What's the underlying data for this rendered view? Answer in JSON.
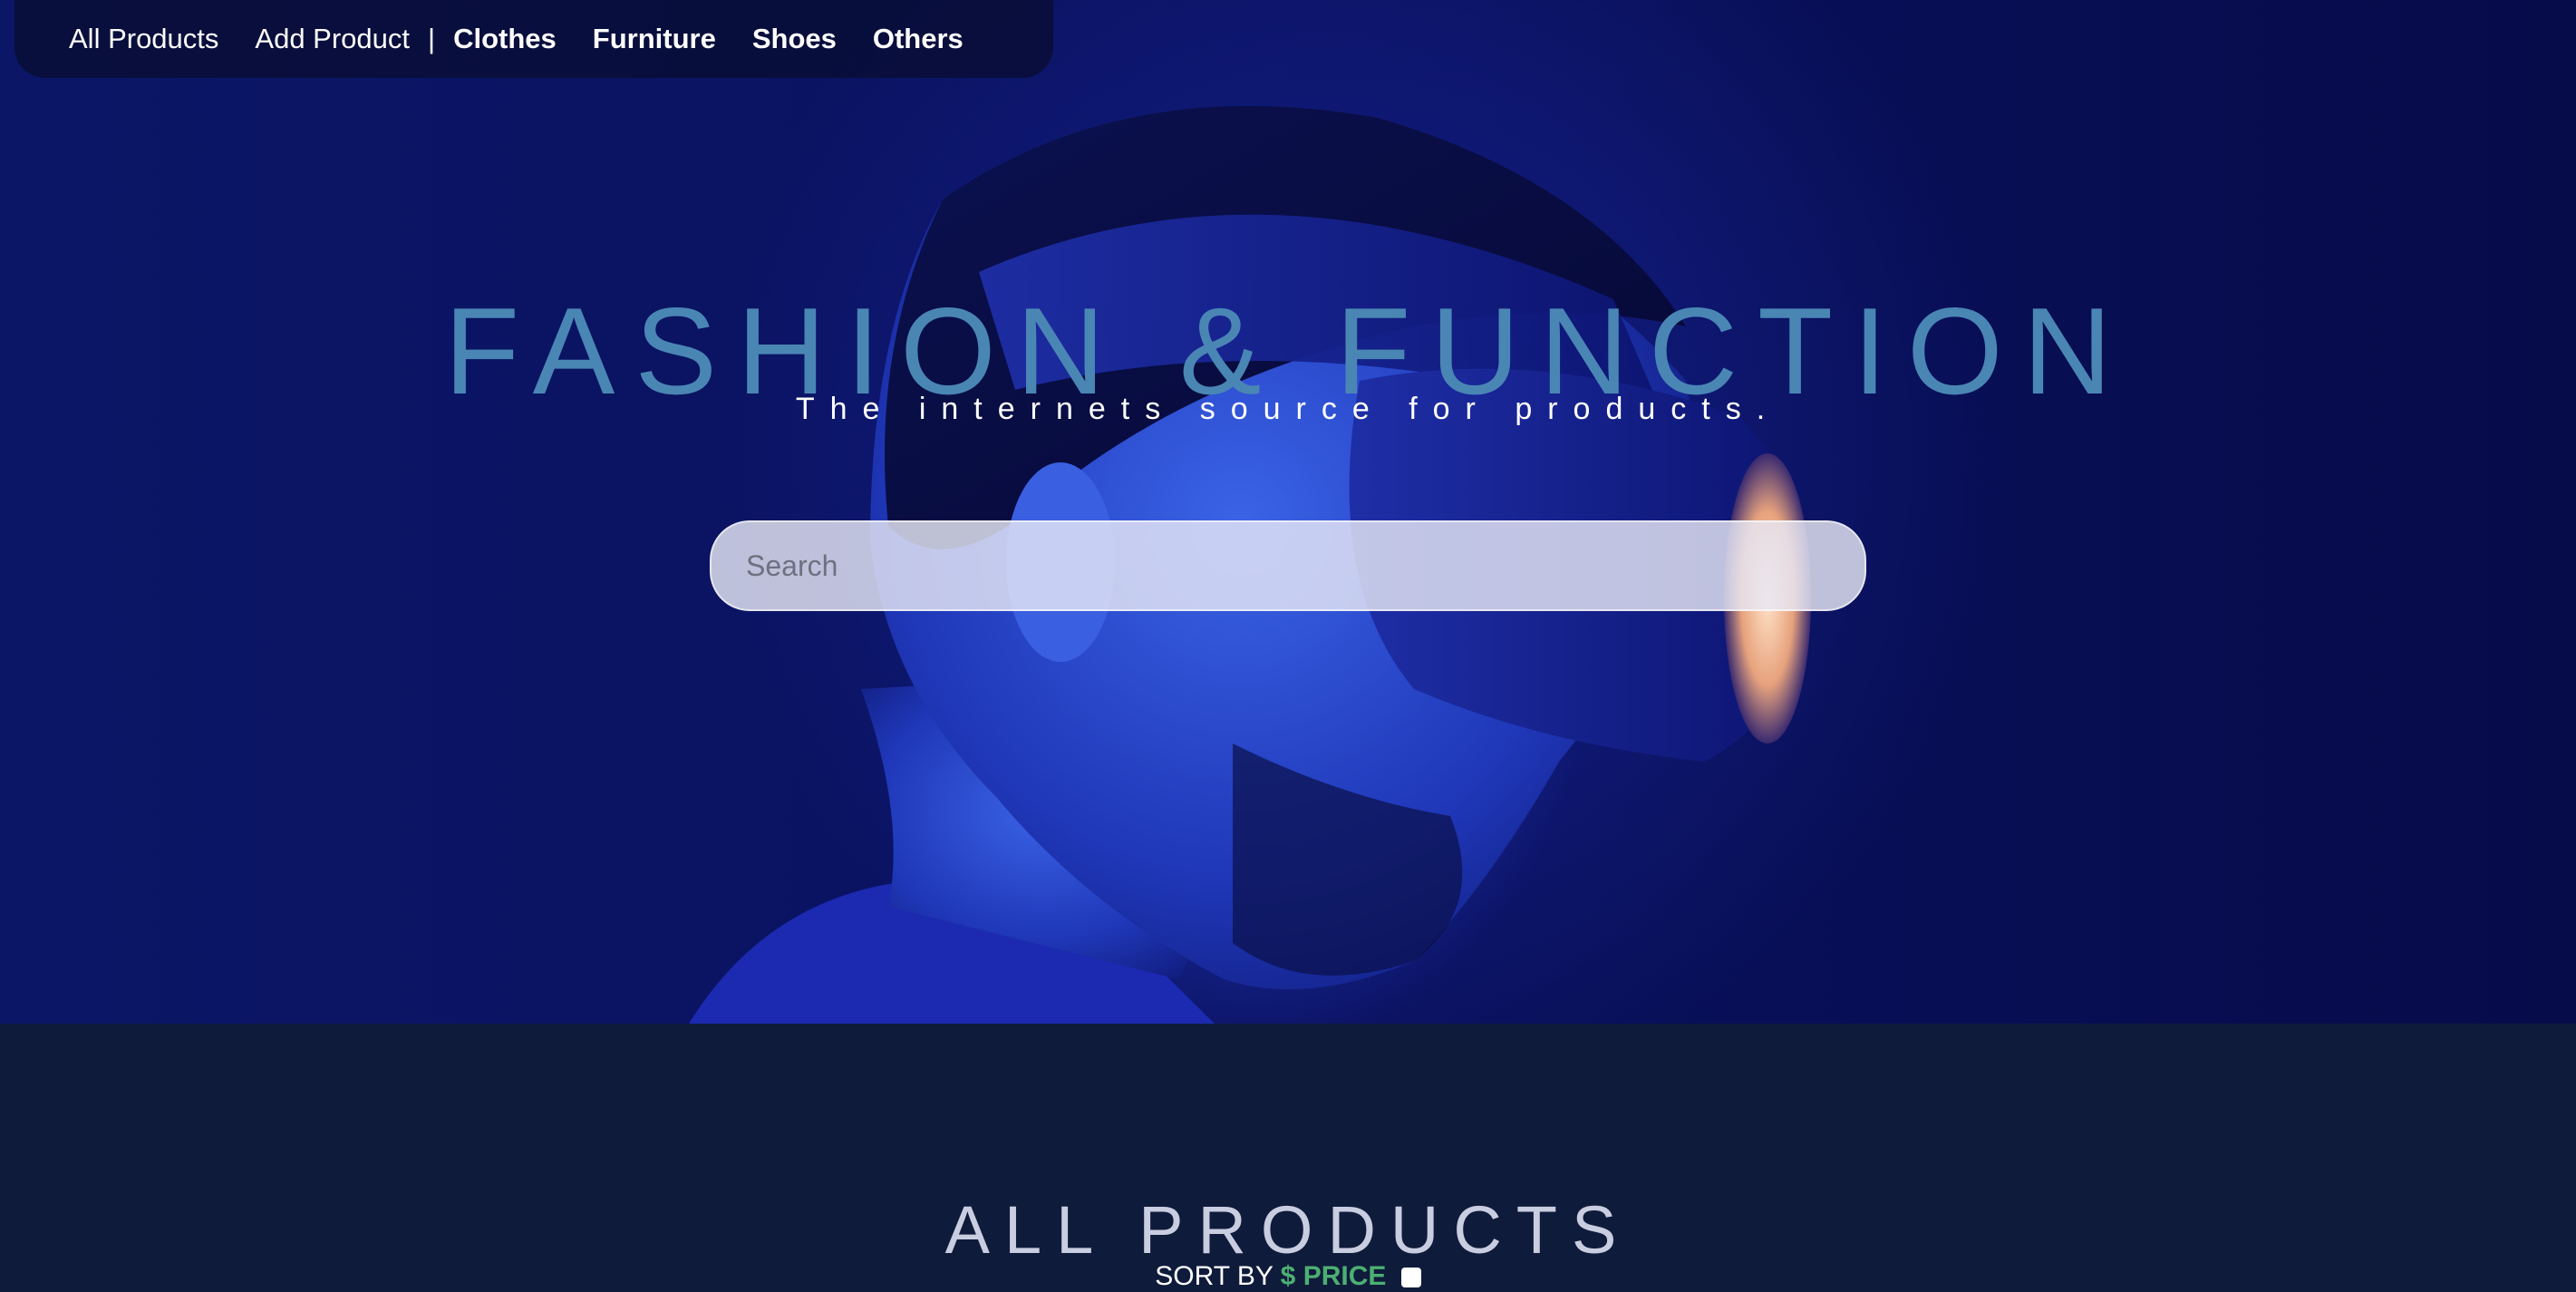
{
  "nav": {
    "all_products": "All Products",
    "add_product": "Add Product",
    "separator": "|",
    "categories": [
      "Clothes",
      "Furniture",
      "Shoes",
      "Others"
    ]
  },
  "hero": {
    "title": "FASHION & FUNCTION",
    "subtitle": "The internets source for products.",
    "search_placeholder": "Search"
  },
  "products": {
    "title": "ALL PRODUCTS",
    "sort_label": "SORT BY",
    "sort_field": "$ PRICE"
  },
  "colors": {
    "title_blue": "#4a86b4",
    "price_green": "#4caf72",
    "section_bg": "#0f1b3b"
  }
}
